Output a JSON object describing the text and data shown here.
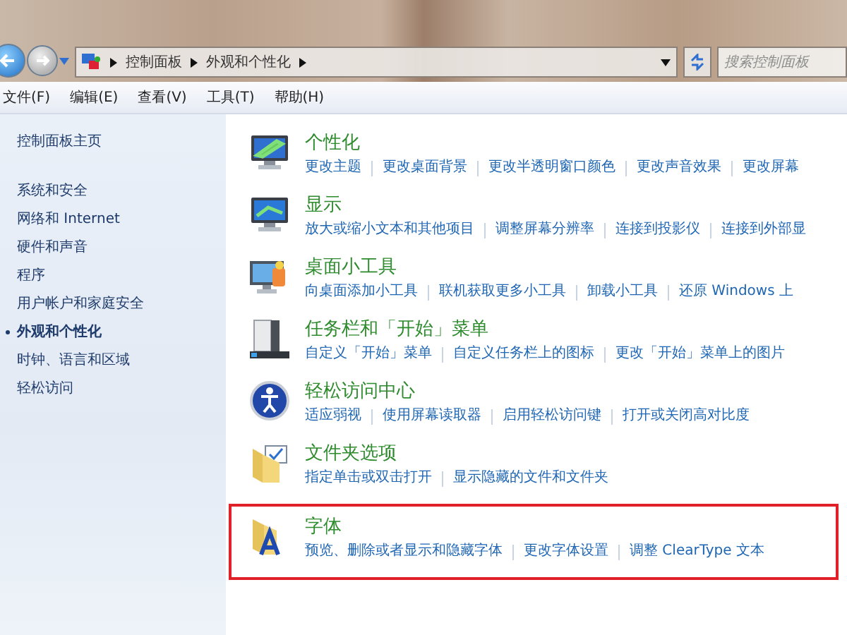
{
  "address_bar": {
    "breadcrumbs": [
      "控制面板",
      "外观和个性化"
    ],
    "search": {
      "placeholder": "搜索控制面板"
    }
  },
  "menu": [
    "文件(F)",
    "编辑(E)",
    "查看(V)",
    "工具(T)",
    "帮助(H)"
  ],
  "sidebar": {
    "home": "控制面板主页",
    "items": [
      {
        "label": "系统和安全",
        "selected": false
      },
      {
        "label": "网络和 Internet",
        "selected": false
      },
      {
        "label": "硬件和声音",
        "selected": false
      },
      {
        "label": "程序",
        "selected": false
      },
      {
        "label": "用户帐户和家庭安全",
        "selected": false
      },
      {
        "label": "外观和个性化",
        "selected": true
      },
      {
        "label": "时钟、语言和区域",
        "selected": false
      },
      {
        "label": "轻松访问",
        "selected": false
      }
    ]
  },
  "categories": [
    {
      "kind": "personalize",
      "title": "个性化",
      "links": [
        "更改主题",
        "更改桌面背景",
        "更改半透明窗口颜色",
        "更改声音效果",
        "更改屏幕"
      ],
      "highlighted": false
    },
    {
      "kind": "display",
      "title": "显示",
      "links": [
        "放大或缩小文本和其他项目",
        "调整屏幕分辨率",
        "连接到投影仪",
        "连接到外部显"
      ],
      "highlighted": false
    },
    {
      "kind": "gadgets",
      "title": "桌面小工具",
      "links": [
        "向桌面添加小工具",
        "联机获取更多小工具",
        "卸载小工具",
        "还原 Windows 上"
      ],
      "highlighted": false
    },
    {
      "kind": "taskbar",
      "title": "任务栏和「开始」菜单",
      "links": [
        "自定义「开始」菜单",
        "自定义任务栏上的图标",
        "更改「开始」菜单上的图片"
      ],
      "highlighted": false
    },
    {
      "kind": "ease",
      "title": "轻松访问中心",
      "links": [
        "适应弱视",
        "使用屏幕读取器",
        "启用轻松访问键",
        "打开或关闭高对比度"
      ],
      "highlighted": false
    },
    {
      "kind": "folder",
      "title": "文件夹选项",
      "links": [
        "指定单击或双击打开",
        "显示隐藏的文件和文件夹"
      ],
      "highlighted": false
    },
    {
      "kind": "fonts",
      "title": "字体",
      "links": [
        "预览、删除或者显示和隐藏字体",
        "更改字体设置",
        "调整 ClearType 文本"
      ],
      "highlighted": true
    }
  ]
}
